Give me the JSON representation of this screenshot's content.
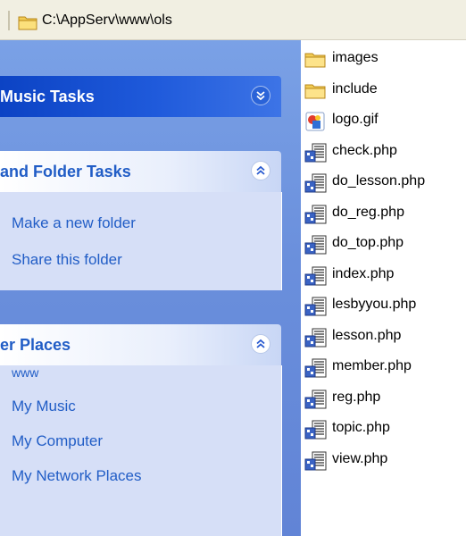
{
  "address_bar": {
    "path": "C:\\AppServ\\www\\ols"
  },
  "task_pane": {
    "music_tasks": {
      "title": "Music Tasks",
      "state": "collapsed"
    },
    "file_folder_tasks": {
      "title": "and Folder Tasks",
      "state": "expanded",
      "links": [
        "Make a new folder",
        "Share this folder"
      ]
    },
    "other_places": {
      "title": "er Places",
      "state": "expanded",
      "links": [
        "www",
        "My Music",
        "My Computer",
        "My Network Places"
      ]
    }
  },
  "files": [
    {
      "name": "images",
      "icon": "folder-icon"
    },
    {
      "name": "include",
      "icon": "folder-icon"
    },
    {
      "name": "logo.gif",
      "icon": "image-file-icon"
    },
    {
      "name": "check.php",
      "icon": "php-file-icon"
    },
    {
      "name": "do_lesson.php",
      "icon": "php-file-icon"
    },
    {
      "name": "do_reg.php",
      "icon": "php-file-icon"
    },
    {
      "name": "do_top.php",
      "icon": "php-file-icon"
    },
    {
      "name": "index.php",
      "icon": "php-file-icon"
    },
    {
      "name": "lesbyyou.php",
      "icon": "php-file-icon"
    },
    {
      "name": "lesson.php",
      "icon": "php-file-icon"
    },
    {
      "name": "member.php",
      "icon": "php-file-icon"
    },
    {
      "name": "reg.php",
      "icon": "php-file-icon"
    },
    {
      "name": "topic.php",
      "icon": "php-file-icon"
    },
    {
      "name": "view.php",
      "icon": "php-file-icon"
    }
  ],
  "colors": {
    "pane_background": "#6a8fdc",
    "header_dark": "#0c43c4",
    "header_light_text": "#215dc6",
    "panel_body": "#d6dff7",
    "link": "#215dc6"
  }
}
